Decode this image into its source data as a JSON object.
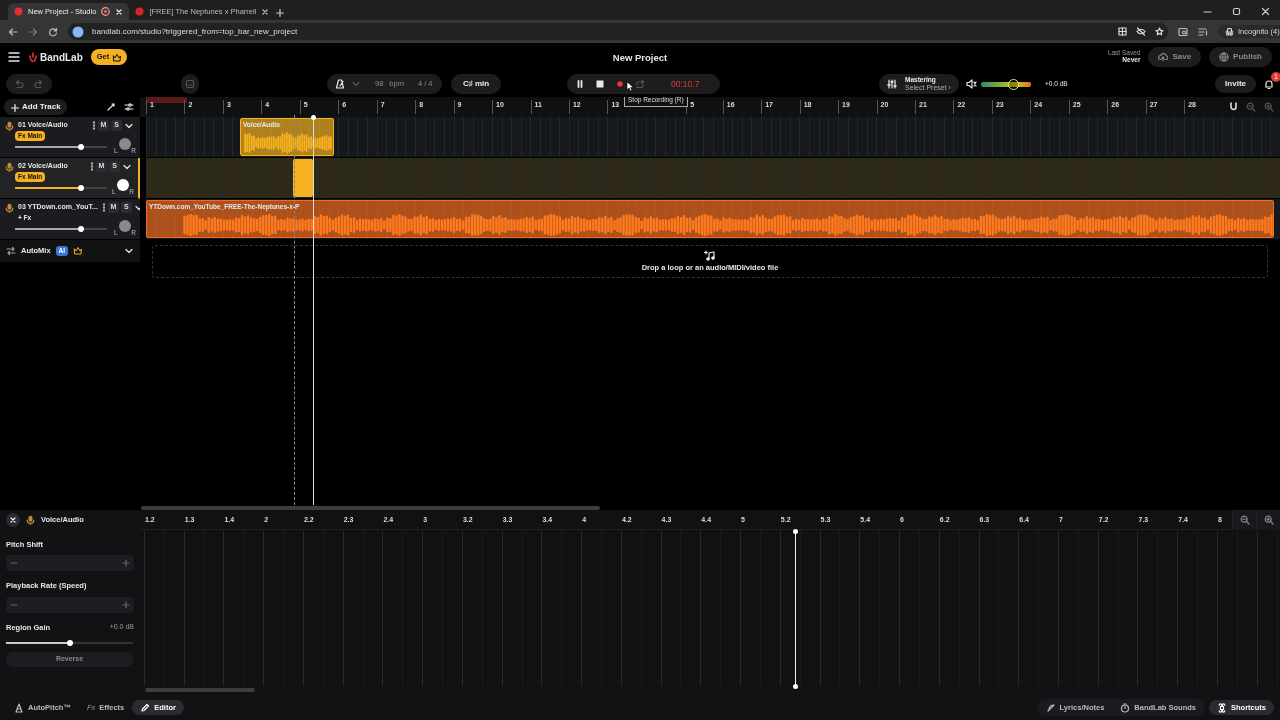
{
  "browser": {
    "tabs": [
      {
        "title": "New Project - Studio",
        "selected": true,
        "recording": true
      },
      {
        "title": "[FREE] The Neptunes x Pharrell",
        "selected": false,
        "recording": false
      }
    ],
    "address": "bandlab.com/studio?triggered_from=top_bar_new_project",
    "profile": "Incognito (4)"
  },
  "header": {
    "logo": "BandLab",
    "get_button": "Get",
    "title": "New Project",
    "last_saved_label": "Last Saved",
    "last_saved_value": "Never",
    "save_button": {
      "label": "Save",
      "disabled": true
    },
    "publish_button": {
      "label": "Publish",
      "disabled": true
    }
  },
  "toolbar": {
    "tempo": "98",
    "tempo_unit": "bpm",
    "time_signature": "4 / 4",
    "key": "C♯ min",
    "recording": true,
    "time": "00:10.7",
    "mastering_title": "Mastering",
    "mastering_preset": "Select Preset ›",
    "master_volume": {
      "level": 0.64
    },
    "master_gain": "+0.0 dB",
    "invite_button": "Invite",
    "notification_count": "1"
  },
  "tooltip": "Stop Recording (R)",
  "add_track_button": "Add Track",
  "ruler": [
    "1",
    "2",
    "3",
    "4",
    "5",
    "6",
    "7",
    "8",
    "9",
    "10",
    "11",
    "12",
    "13",
    "5",
    "16",
    "17",
    "18",
    "19",
    "20",
    "21",
    "22",
    "23",
    "24",
    "25",
    "26",
    "27",
    "28"
  ],
  "tracks": [
    {
      "number": "01",
      "name": "Voice/Audio",
      "fx": "Fx Main",
      "fx_active": true,
      "mute": "M",
      "solo": "S",
      "pan_labels": [
        "L",
        "R"
      ],
      "volume": {
        "level": 0.72
      },
      "selected": false,
      "color": "#f5b120",
      "region": {
        "kind": "clip",
        "label": "Voice/Audio"
      }
    },
    {
      "number": "02",
      "name": "Voice/Audio",
      "fx": "Fx Main",
      "fx_active": true,
      "mute": "M",
      "solo": "S",
      "pan_labels": [
        "L",
        "R"
      ],
      "volume": {
        "level": 0.72
      },
      "selected": true,
      "color": "#f5b120",
      "region": {
        "kind": "recording"
      }
    },
    {
      "number": "03",
      "name": "YTDown.com_YouT...",
      "fx": "+ Fx",
      "fx_active": false,
      "mute": "M",
      "solo": "S",
      "pan_labels": [
        "L",
        "R"
      ],
      "volume": {
        "level": 0.72
      },
      "selected": false,
      "color": "#f26b1d",
      "region": {
        "kind": "clip",
        "label": "YTDown.com_YouTube_FREE-The-Neptunes-x-P"
      }
    }
  ],
  "automix": {
    "label": "AutoMix",
    "badge": "AI"
  },
  "drop_zone": "Drop a loop or an audio/MIDI/video file",
  "editor": {
    "track_name": "Voice/Audio",
    "pitch_shift_label": "Pitch Shift",
    "playback_rate_label": "Playback Rate (Speed)",
    "region_gain_label": "Region Gain",
    "region_gain_value": "+0.0 dB",
    "gain": {
      "level": 0.5
    },
    "reverse_button": "Reverse",
    "controls_disabled": true,
    "ruler": [
      "1.2",
      "1.3",
      "1.4",
      "2",
      "2.2",
      "2.3",
      "2.4",
      "3",
      "3.2",
      "3.3",
      "3.4",
      "4",
      "4.2",
      "4.3",
      "4.4",
      "5",
      "5.2",
      "5.3",
      "5.4",
      "6",
      "6.2",
      "6.3",
      "6.4",
      "7",
      "7.2",
      "7.3",
      "7.4",
      "8"
    ]
  },
  "bottom_tabs": [
    {
      "label": "AutoPitch™",
      "selected": false
    },
    {
      "label": "Effects",
      "prefix": "Fx",
      "selected": false
    },
    {
      "label": "Editor",
      "selected": true
    }
  ],
  "bottom_right": [
    {
      "label": "Lyrics/Notes",
      "selected": false
    },
    {
      "label": "BandLab Sounds",
      "selected": false
    },
    {
      "label": "Shortcuts",
      "selected": true
    }
  ]
}
